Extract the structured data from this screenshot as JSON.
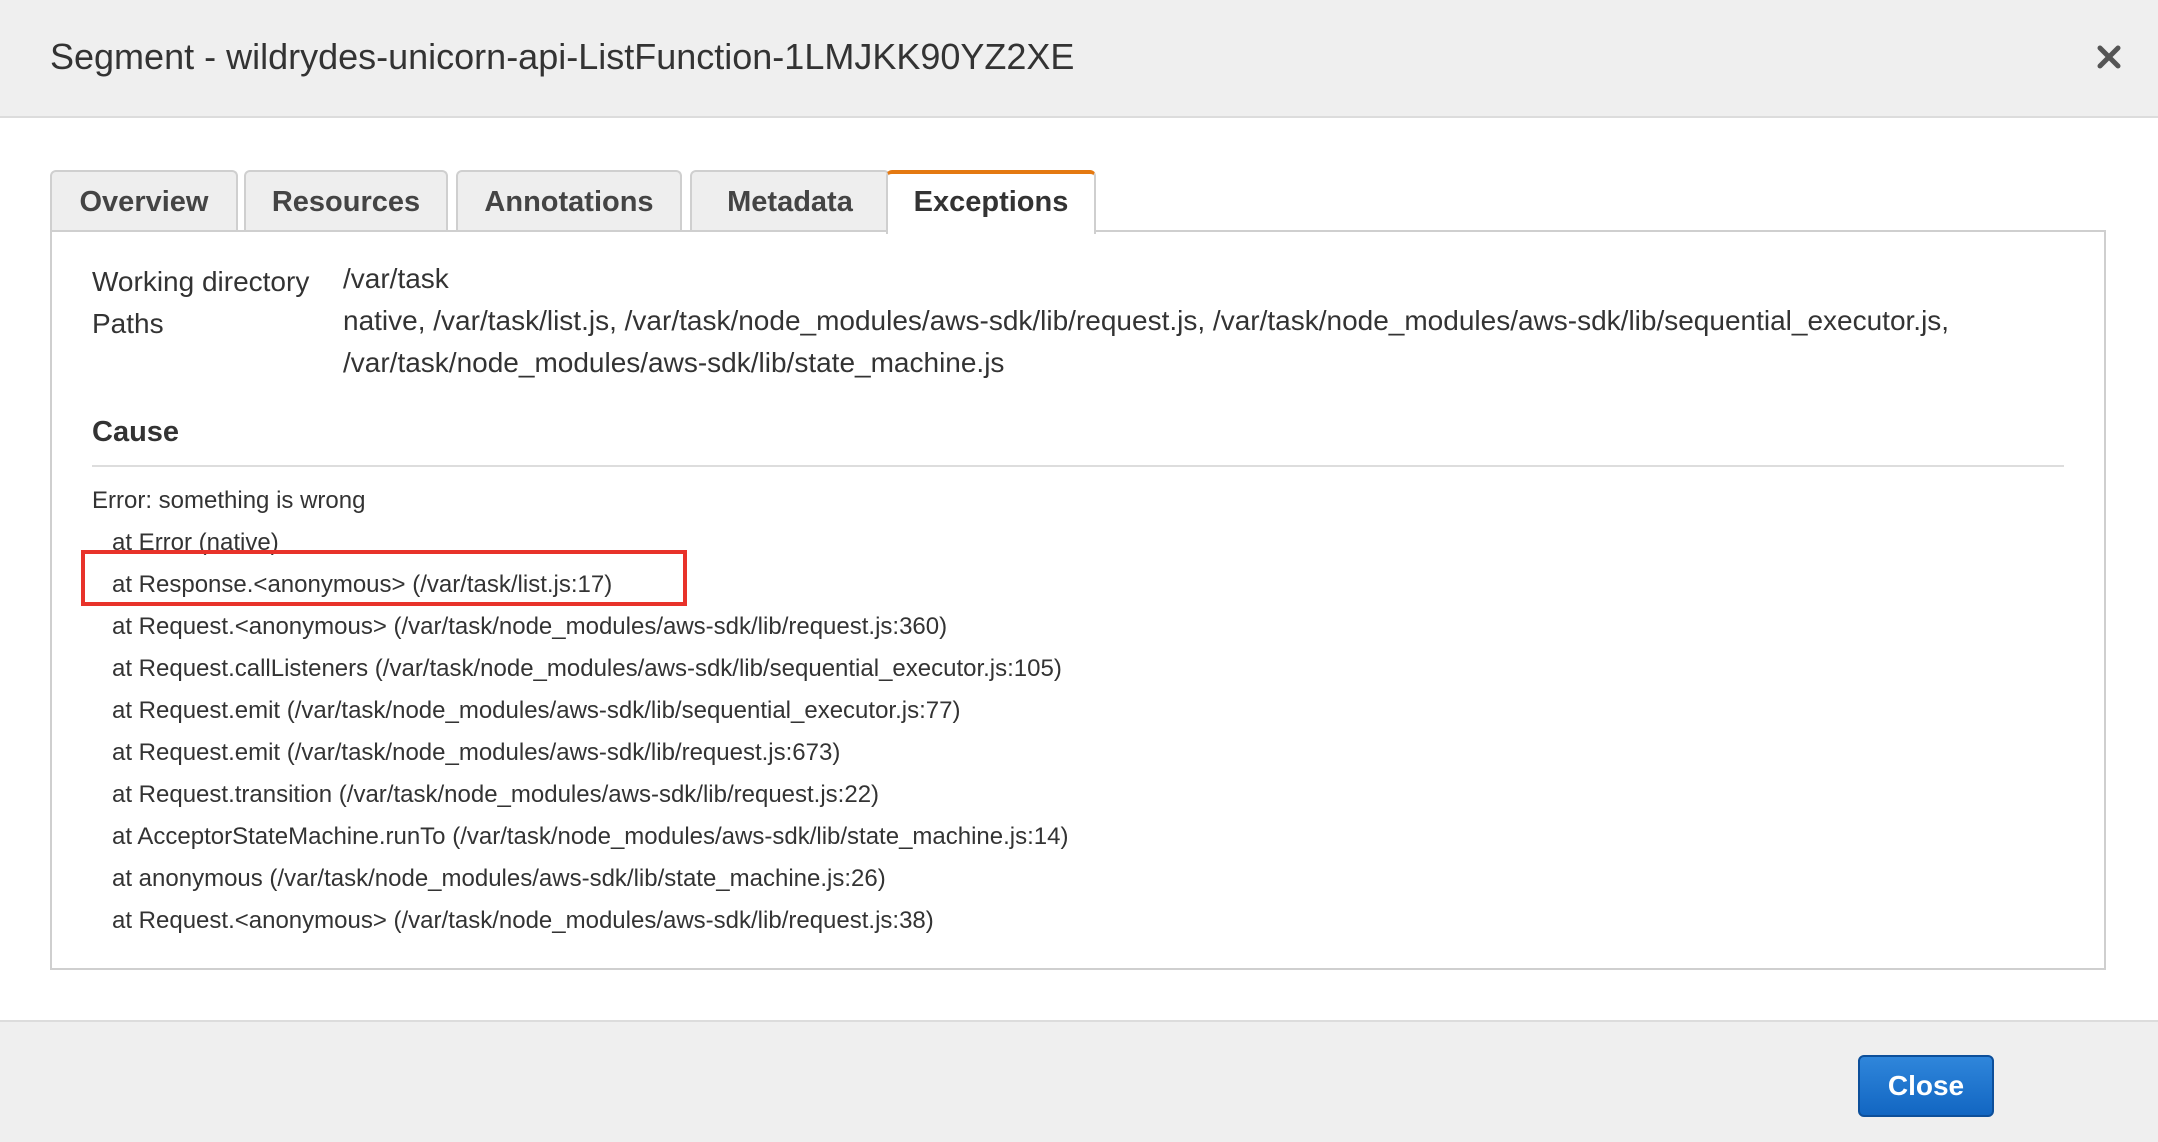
{
  "dialog": {
    "title": "Segment - wildrydes-unicorn-api-ListFunction-1LMJKK90YZ2XE",
    "close_icon": "close-icon"
  },
  "tabs": [
    {
      "label": "Overview",
      "active": false
    },
    {
      "label": "Resources",
      "active": false
    },
    {
      "label": "Annotations",
      "active": false
    },
    {
      "label": "Metadata",
      "active": false
    },
    {
      "label": "Exceptions",
      "active": true
    }
  ],
  "details": {
    "working_directory_label": "Working directory",
    "working_directory_value": "/var/task",
    "paths_label": "Paths",
    "paths_line1": "native, /var/task/list.js, /var/task/node_modules/aws-sdk/lib/request.js, /var/task/node_modules/aws-sdk/lib/sequential_executor.js,",
    "paths_line2": "/var/task/node_modules/aws-sdk/lib/state_machine.js"
  },
  "cause": {
    "heading": "Cause",
    "error_message": "Error: something is wrong",
    "stack": [
      "at Error (native)",
      "at Response.<anonymous> (/var/task/list.js:17)",
      "at Request.<anonymous> (/var/task/node_modules/aws-sdk/lib/request.js:360)",
      "at Request.callListeners (/var/task/node_modules/aws-sdk/lib/sequential_executor.js:105)",
      "at Request.emit (/var/task/node_modules/aws-sdk/lib/sequential_executor.js:77)",
      "at Request.emit (/var/task/node_modules/aws-sdk/lib/request.js:673)",
      "at Request.transition (/var/task/node_modules/aws-sdk/lib/request.js:22)",
      "at AcceptorStateMachine.runTo (/var/task/node_modules/aws-sdk/lib/state_machine.js:14)",
      "at anonymous (/var/task/node_modules/aws-sdk/lib/state_machine.js:26)",
      "at Request.<anonymous> (/var/task/node_modules/aws-sdk/lib/request.js:38)"
    ]
  },
  "footer": {
    "close_label": "Close"
  },
  "colors": {
    "active_tab_accent": "#e47911",
    "highlight_box": "#e8322a",
    "primary_button": "#1a73cf"
  }
}
